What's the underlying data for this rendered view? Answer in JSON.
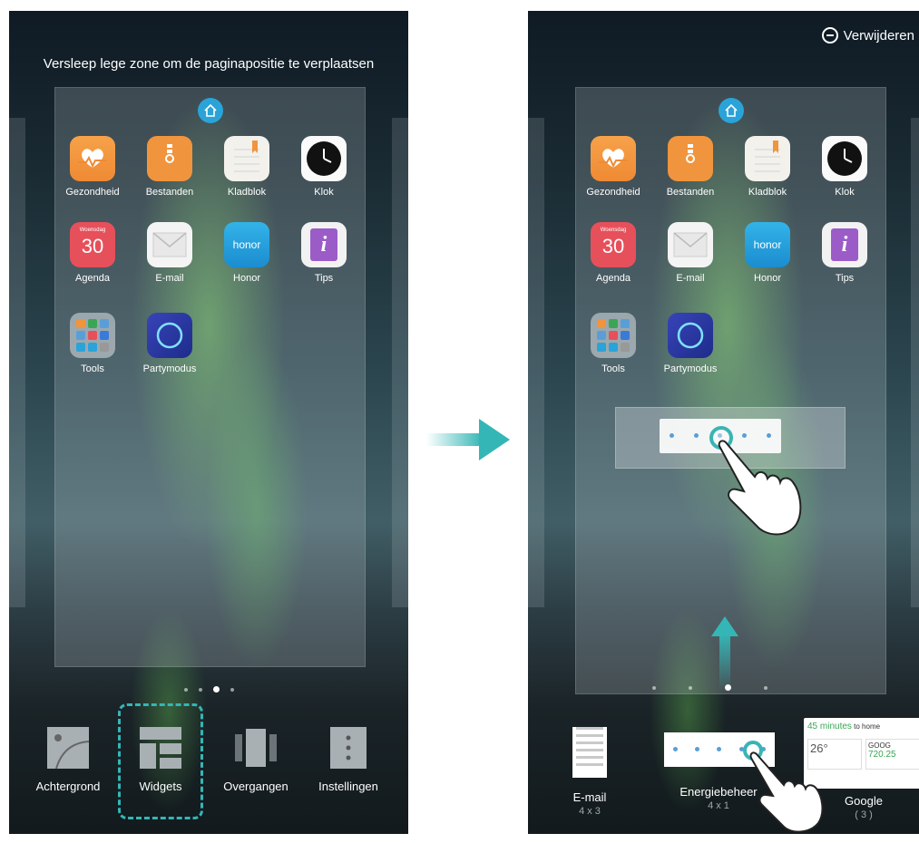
{
  "left_phone": {
    "hint": "Versleep lege zone om de paginapositie te verplaatsen",
    "apps": [
      {
        "label": "Gezondheid"
      },
      {
        "label": "Bestanden"
      },
      {
        "label": "Kladblok"
      },
      {
        "label": "Klok"
      },
      {
        "label": "Agenda",
        "day_name": "Woensdag",
        "day_number": "30"
      },
      {
        "label": "E-mail"
      },
      {
        "label": "Honor",
        "icon_text": "honor"
      },
      {
        "label": "Tips"
      },
      {
        "label": "Tools"
      },
      {
        "label": "Partymodus"
      }
    ],
    "page_dots": {
      "count": 4,
      "active": 3
    },
    "menu": [
      {
        "label": "Achtergrond",
        "icon": "wallpaper-icon"
      },
      {
        "label": "Widgets",
        "icon": "widgets-icon"
      },
      {
        "label": "Overgangen",
        "icon": "transitions-icon"
      },
      {
        "label": "Instellingen",
        "icon": "settings-icon"
      }
    ]
  },
  "right_phone": {
    "remove_label": "Verwijderen",
    "apps": [
      {
        "label": "Gezondheid"
      },
      {
        "label": "Bestanden"
      },
      {
        "label": "Kladblok"
      },
      {
        "label": "Klok"
      },
      {
        "label": "Agenda",
        "day_name": "Woensdag",
        "day_number": "30"
      },
      {
        "label": "E-mail"
      },
      {
        "label": "Honor",
        "icon_text": "honor"
      },
      {
        "label": "Tips"
      },
      {
        "label": "Tools"
      },
      {
        "label": "Partymodus"
      }
    ],
    "page_dots": {
      "count": 5,
      "active": 3
    },
    "widget_tray": [
      {
        "label": "E-mail",
        "size": "4 x 3"
      },
      {
        "label": "Energiebeheer",
        "size": "4 x 1"
      },
      {
        "label": "Google",
        "size": "( 3 )",
        "preview": {
          "eta": "45 minutes",
          "eta_suffix": "to home",
          "temp": "26°",
          "ticker": "GOOG",
          "price": "720.25"
        }
      }
    ]
  },
  "colors": {
    "accent_teal": "#35b6b6",
    "home_blue": "#2aa3d9"
  }
}
